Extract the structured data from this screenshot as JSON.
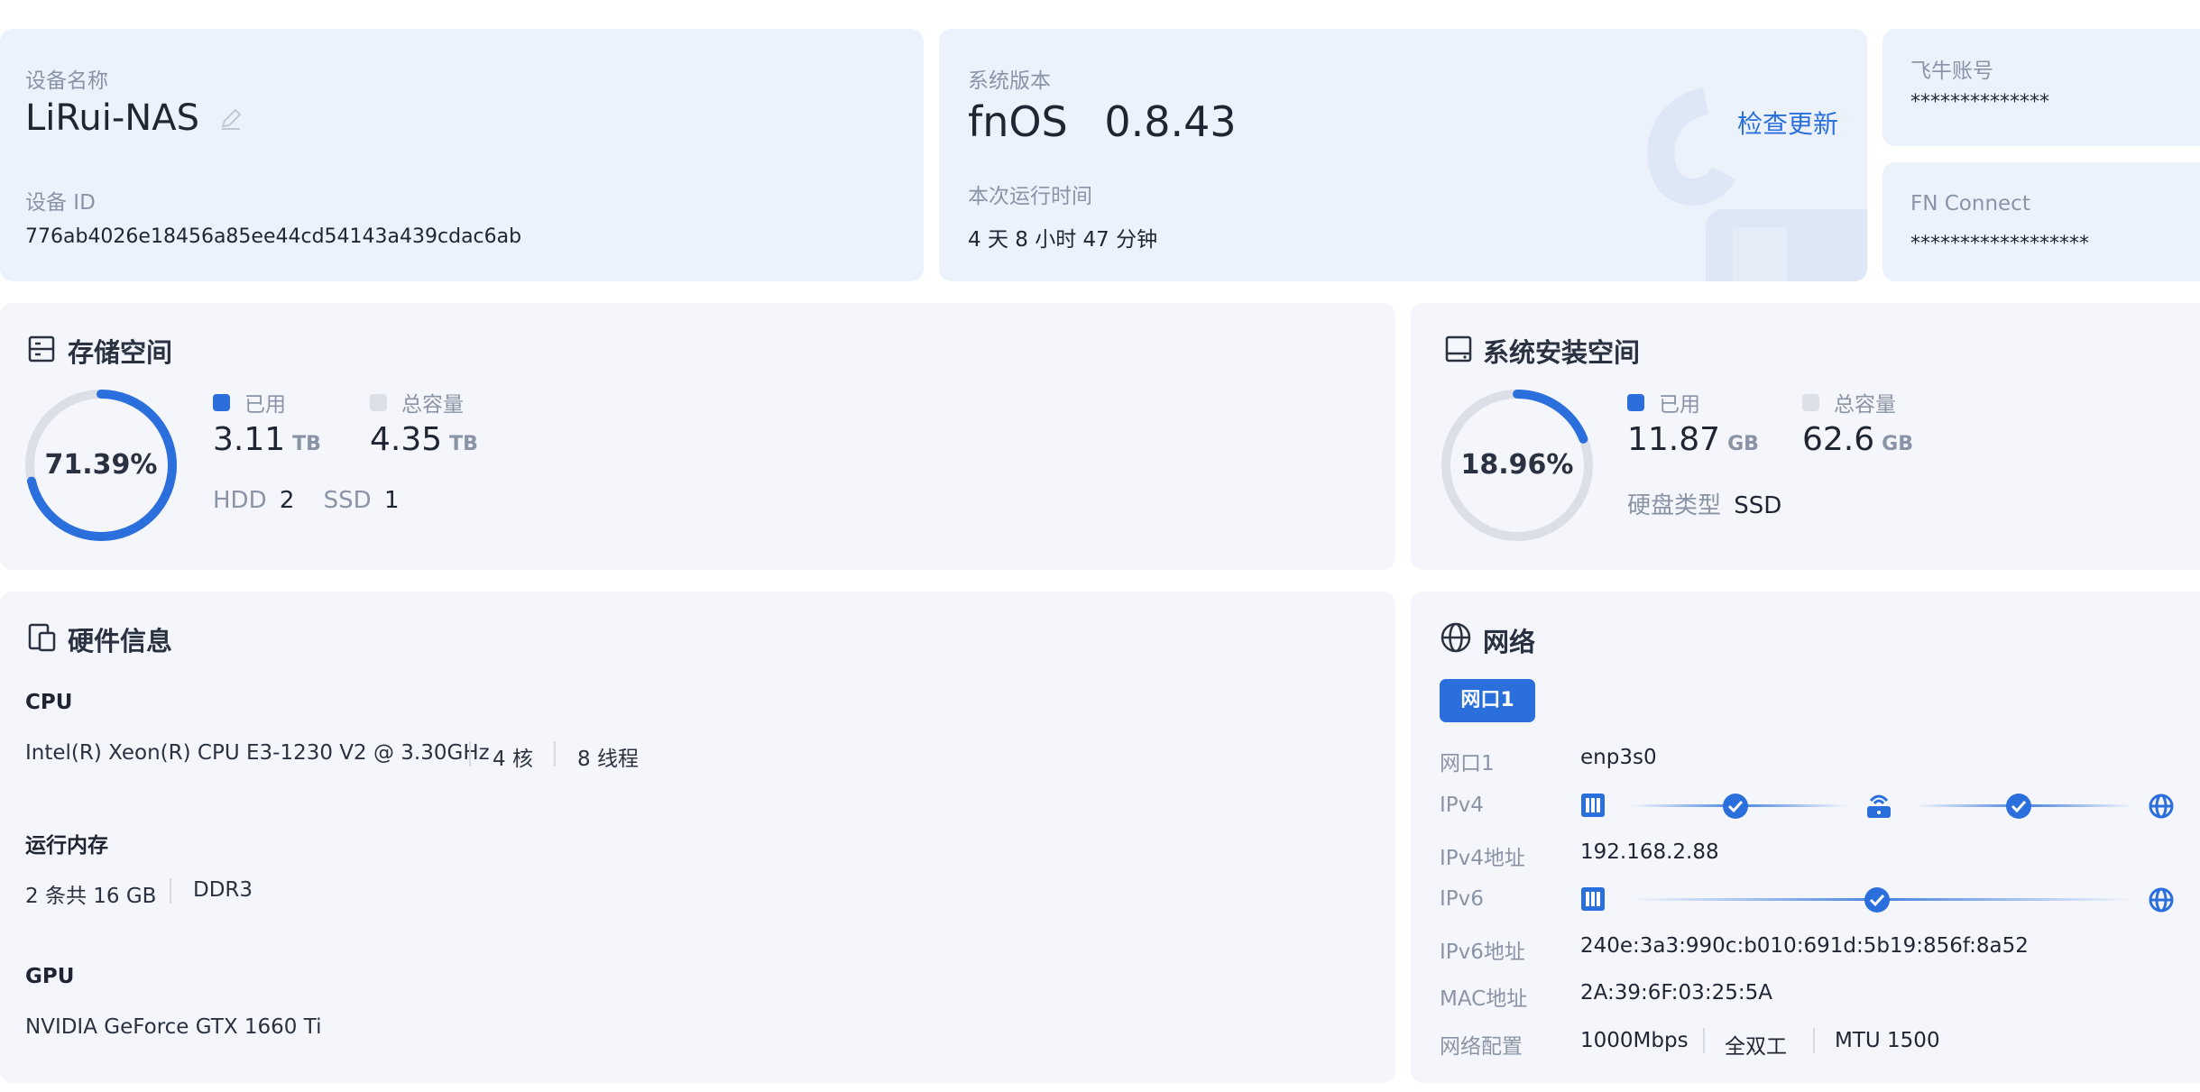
{
  "device": {
    "name_label": "设备名称",
    "name": "LiRui-NAS",
    "id_label": "设备 ID",
    "id": "776ab4026e18456a85ee44cd54143a439cdac6ab"
  },
  "system": {
    "version_label": "系统版本",
    "os_name": "fnOS",
    "os_version": "0.8.43",
    "check_update": "检查更新",
    "uptime_label": "本次运行时间",
    "uptime": "4 天 8 小时 47 分钟"
  },
  "account": {
    "feiniu_label": "飞牛账号",
    "feiniu_value": "**************",
    "fnconnect_label": "FN Connect",
    "fnconnect_value": "******************"
  },
  "storage": {
    "title": "存储空间",
    "percent_text": "71.39%",
    "percent_value": 71.39,
    "used_label": "已用",
    "used_value": "3.11",
    "used_unit": "TB",
    "total_label": "总容量",
    "total_value": "4.35",
    "total_unit": "TB",
    "hdd_label": "HDD",
    "hdd_count": "2",
    "ssd_label": "SSD",
    "ssd_count": "1"
  },
  "sys_storage": {
    "title": "系统安装空间",
    "percent_text": "18.96%",
    "percent_value": 18.96,
    "used_label": "已用",
    "used_value": "11.87",
    "used_unit": "GB",
    "total_label": "总容量",
    "total_value": "62.6",
    "total_unit": "GB",
    "disk_type_label": "硬盘类型",
    "disk_type": "SSD"
  },
  "hardware": {
    "title": "硬件信息",
    "cpu_label": "CPU",
    "cpu_model": "Intel(R) Xeon(R) CPU E3-1230 V2 @ 3.30GHz",
    "cpu_cores": "4 核",
    "cpu_threads": "8 线程",
    "ram_label": "运行内存",
    "ram_size": "2 条共 16 GB",
    "ram_type": "DDR3",
    "gpu_label": "GPU",
    "gpu_model": "NVIDIA GeForce GTX 1660 Ti"
  },
  "network": {
    "title": "网络",
    "tab": "网口1",
    "port_label": "网口1",
    "port_value": "enp3s0",
    "ipv4_label": "IPv4",
    "ipv4_addr_label": "IPv4地址",
    "ipv4_addr": "192.168.2.88",
    "ipv6_label": "IPv6",
    "ipv6_addr_label": "IPv6地址",
    "ipv6_addr": "240e:3a3:990c:b010:691d:5b19:856f:8a52",
    "mac_label": "MAC地址",
    "mac": "2A:39:6F:03:25:5A",
    "config_label": "网络配置",
    "speed": "1000Mbps",
    "duplex": "全双工",
    "mtu": "MTU 1500"
  },
  "colors": {
    "accent": "#2a6fdb",
    "ring_track": "#dcdfe8",
    "card_bg": "#f4f6fb",
    "card_blue": "#ebf2fc"
  },
  "icons": [
    "edit-icon",
    "storage-icon",
    "disk-icon",
    "hardware-icon",
    "globe-icon",
    "network-port-icon",
    "router-icon",
    "check-icon"
  ]
}
